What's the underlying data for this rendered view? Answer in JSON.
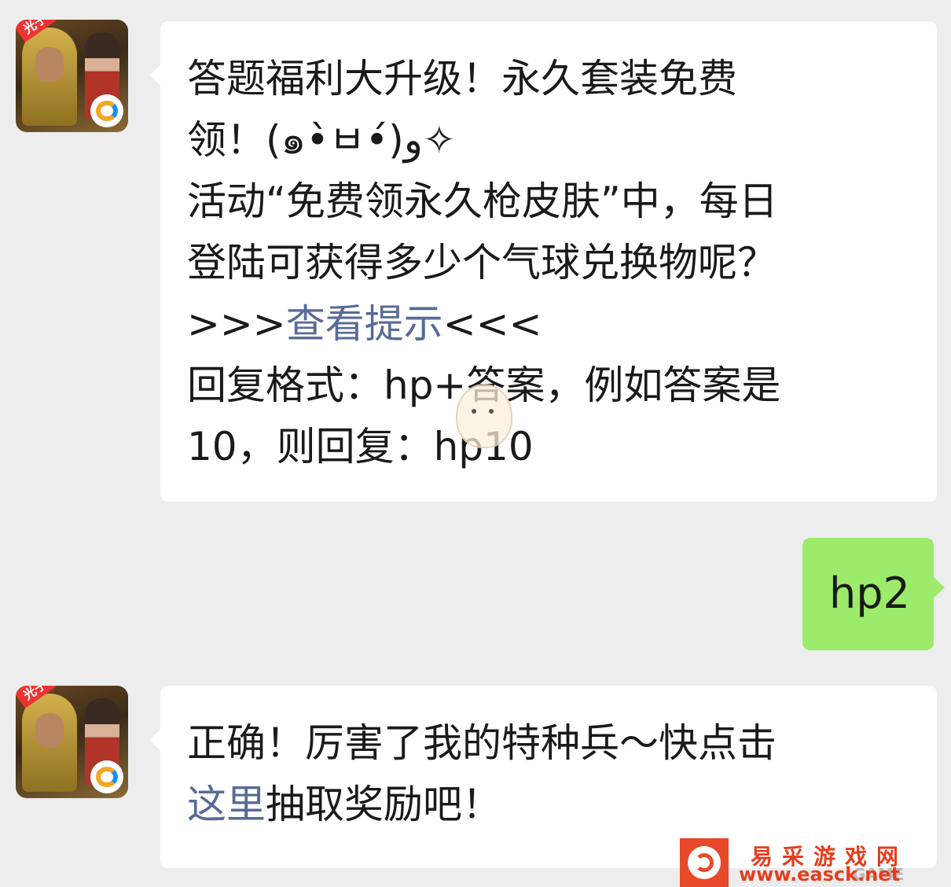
{
  "conversation": {
    "message1": {
      "lines": [
        "答题福利大升级！永久套装免费",
        "领！(๑•̀ㅂ•́)و✧",
        "活动“免费领永久枪皮肤”中，每日",
        "登陆可获得多少个气球兑换物呢？"
      ],
      "hint_prefix": ">>>",
      "hint_link": "查看提示",
      "hint_suffix": "<<<",
      "reply_format_line1": "回复格式：hp+答案，例如答案是",
      "reply_format_line2": "10，则回复：hp10"
    },
    "message2": {
      "text": "hp2"
    },
    "message3": {
      "line1": "正确！厉害了我的特种兵～快点击",
      "link": "这里",
      "line2_rest": "抽取奖励吧！"
    }
  },
  "avatar": {
    "badge": "光子"
  },
  "watermark": {
    "site_name": "易采游戏网",
    "url": "www.easck.net",
    "game_text": "GAME"
  }
}
